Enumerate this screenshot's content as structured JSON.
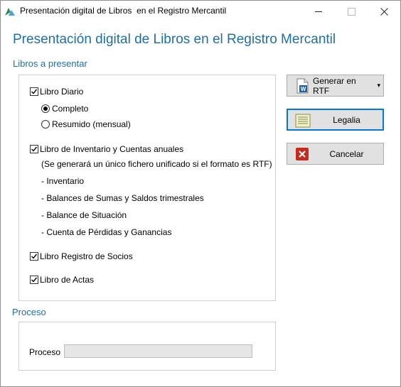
{
  "window": {
    "title": "Presentación digital de Libros  en el Registro Mercantil",
    "heading": "Presentación digital de Libros en el Registro Mercantil"
  },
  "books_section": {
    "label": "Libros a presentar",
    "libro_diario": {
      "label": "Libro Diario",
      "checked": true,
      "options": [
        {
          "label": "Completo",
          "selected": true
        },
        {
          "label": "Resumido (mensual)",
          "selected": false
        }
      ]
    },
    "inventario": {
      "label": "Libro de Inventario y Cuentas anuales",
      "checked": true,
      "note": "(Se generará un único fichero unificado si el formato es RTF)",
      "items": [
        "- Inventario",
        "- Balances de Sumas y Saldos trimestrales",
        "- Balance de Situación",
        "- Cuenta de Pérdidas y Ganancias"
      ]
    },
    "socios": {
      "label": "Libro Registro de Socios",
      "checked": true
    },
    "actas": {
      "label": "Libro de Actas",
      "checked": true
    }
  },
  "buttons": {
    "generar": "Generar en RTF",
    "legalia": "Legalia",
    "cancelar": "Cancelar"
  },
  "process_section": {
    "label": "Proceso",
    "progress_label": "Proceso",
    "progress_value": 0
  },
  "colors": {
    "accent": "#1e6fa7",
    "focus": "#0078d7",
    "cancel_red": "#c42b1c"
  },
  "icons": {
    "generar": "word-doc-icon",
    "legalia": "legalia-document-icon",
    "cancelar": "cancel-x-icon"
  }
}
